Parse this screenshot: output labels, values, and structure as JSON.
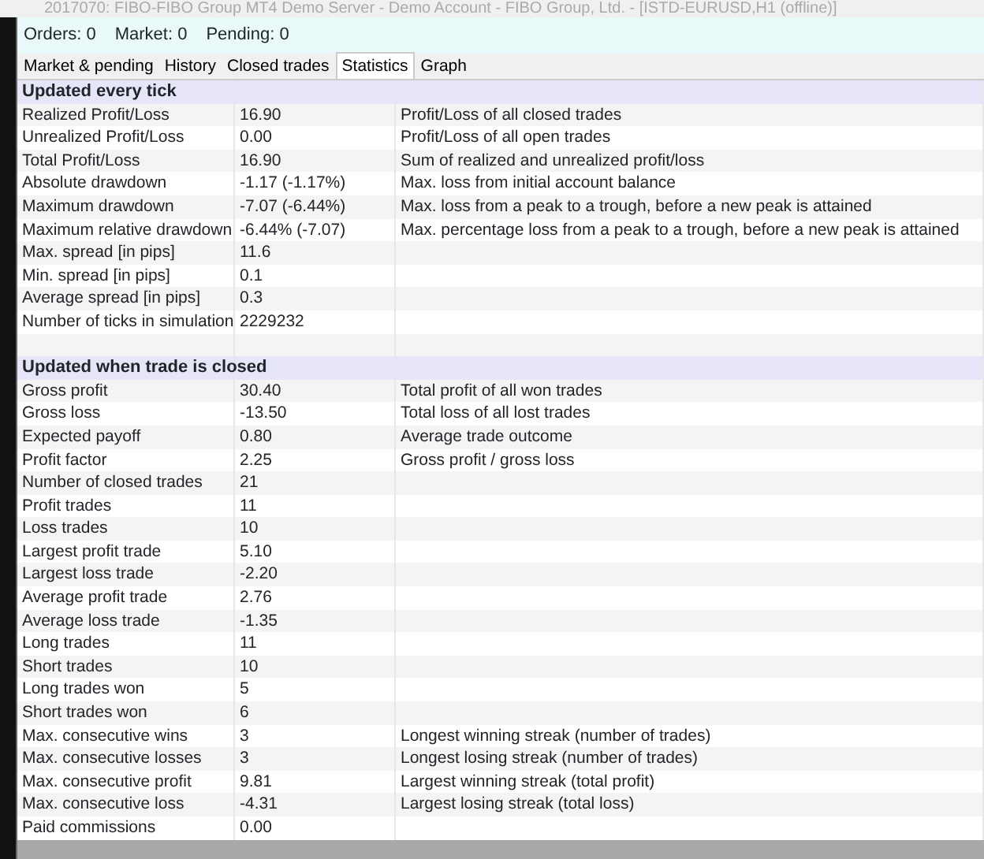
{
  "background_window": {
    "title": "2017070: FIBO-FIBO Group MT4 Demo Server - Demo Account - FIBO Group, Ltd. - [ISTD-EURUSD,H1 (offline)]"
  },
  "summary": [
    "Orders: 0",
    "Market: 0",
    "Pending: 0"
  ],
  "tabs": [
    {
      "label": "Market & pending",
      "selected": false
    },
    {
      "label": "History",
      "selected": false
    },
    {
      "label": "Closed trades",
      "selected": false
    },
    {
      "label": "Statistics",
      "selected": true
    },
    {
      "label": "Graph",
      "selected": false
    }
  ],
  "sections": [
    {
      "title": "Updated every tick",
      "rows": [
        {
          "label": "Realized Profit/Loss",
          "value": "16.90",
          "description": "Profit/Loss of all closed trades"
        },
        {
          "label": "Unrealized Profit/Loss",
          "value": "0.00",
          "description": "Profit/Loss of all open trades"
        },
        {
          "label": "Total Profit/Loss",
          "value": "16.90",
          "description": "Sum of realized and unrealized profit/loss"
        },
        {
          "label": "Absolute drawdown",
          "value": "-1.17 (-1.17%)",
          "description": "Max. loss from initial account balance"
        },
        {
          "label": "Maximum drawdown",
          "value": "-7.07 (-6.44%)",
          "description": "Max. loss from a peak to a trough, before a new peak is attained"
        },
        {
          "label": "Maximum relative drawdown",
          "value": "-6.44% (-7.07)",
          "description": "Max. percentage loss from a peak to a trough, before a new peak is attained"
        },
        {
          "label": "Max. spread [in pips]",
          "value": "11.6"
        },
        {
          "label": "Min. spread [in pips]",
          "value": "0.1"
        },
        {
          "label": "Average spread [in pips]",
          "value": "0.3"
        },
        {
          "label": "Number of ticks in simulation",
          "value": "2229232"
        }
      ]
    },
    {
      "title": "Updated when trade is closed",
      "rows": [
        {
          "label": "Gross profit",
          "value": "30.40",
          "description": "Total profit of all won trades"
        },
        {
          "label": "Gross loss",
          "value": "-13.50",
          "description": "Total loss of all lost trades"
        },
        {
          "label": "Expected payoff",
          "value": "0.80",
          "description": "Average trade outcome"
        },
        {
          "label": "Profit factor",
          "value": "2.25",
          "description": "Gross profit / gross loss"
        },
        {
          "label": "Number of closed trades",
          "value": "21"
        },
        {
          "label": "Profit trades",
          "value": "11"
        },
        {
          "label": "Loss trades",
          "value": "10"
        },
        {
          "label": "Largest profit trade",
          "value": "5.10"
        },
        {
          "label": "Largest loss trade",
          "value": "-2.20"
        },
        {
          "label": "Average profit trade",
          "value": "2.76"
        },
        {
          "label": "Average loss trade",
          "value": "-1.35"
        },
        {
          "label": "Long trades",
          "value": "11"
        },
        {
          "label": "Short trades",
          "value": "10"
        },
        {
          "label": "Long trades won",
          "value": "5"
        },
        {
          "label": "Short trades won",
          "value": "6"
        },
        {
          "label": "Max. consecutive wins",
          "value": "3",
          "description": "Longest winning streak (number of trades)"
        },
        {
          "label": "Max. consecutive losses",
          "value": "3",
          "description": "Longest losing streak (number of trades)"
        },
        {
          "label": "Max. consecutive profit",
          "value": "9.81",
          "description": "Largest winning streak (total profit)"
        },
        {
          "label": "Max. consecutive loss",
          "value": "-4.31",
          "description": "Largest losing streak (total loss)"
        },
        {
          "label": "Paid commissions",
          "value": "0.00"
        }
      ]
    }
  ]
}
